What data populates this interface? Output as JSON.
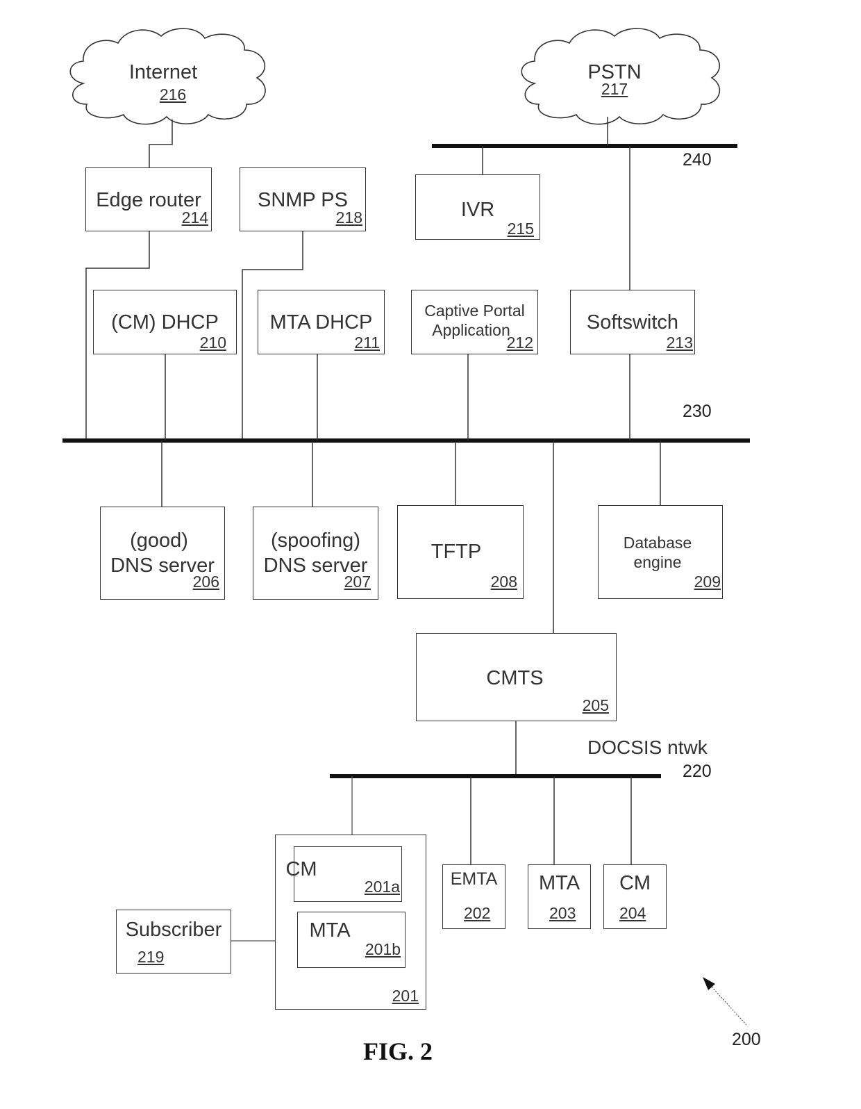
{
  "figure": {
    "caption": "FIG. 2",
    "reference": "200"
  },
  "clouds": {
    "internet": {
      "label": "Internet",
      "ref": "216"
    },
    "pstn": {
      "label": "PSTN",
      "ref": "217"
    }
  },
  "buses": {
    "b240": {
      "label": "240"
    },
    "b230": {
      "label": "230"
    },
    "b220": {
      "name": "DOCSIS ntwk",
      "label": "220"
    }
  },
  "nodes": {
    "edge_router": {
      "label": "Edge router",
      "ref": "214"
    },
    "snmp_ps": {
      "label": "SNMP PS",
      "ref": "218"
    },
    "ivr": {
      "label": "IVR",
      "ref": "215"
    },
    "cm_dhcp": {
      "label": "(CM) DHCP",
      "ref": "210"
    },
    "mta_dhcp": {
      "label": "MTA DHCP",
      "ref": "211"
    },
    "captive_portal": {
      "label_line1": "Captive Portal",
      "label_line2": "Application",
      "ref": "212"
    },
    "softswitch": {
      "label": "Softswitch",
      "ref": "213"
    },
    "good_dns": {
      "label_line1": "(good)",
      "label_line2": "DNS server",
      "ref": "206"
    },
    "spoofing_dns": {
      "label_line1": "(spoofing)",
      "label_line2": "DNS server",
      "ref": "207"
    },
    "tftp": {
      "label": "TFTP",
      "ref": "208"
    },
    "database_engine": {
      "label_line1": "Database",
      "label_line2": "engine",
      "ref": "209"
    },
    "cmts": {
      "label": "CMTS",
      "ref": "205"
    },
    "device_201": {
      "ref": "201"
    },
    "cm_201a": {
      "label": "CM",
      "ref": "201a"
    },
    "mta_201b": {
      "label": "MTA",
      "ref": "201b"
    },
    "emta": {
      "label": "EMTA",
      "ref": "202"
    },
    "mta": {
      "label": "MTA",
      "ref": "203"
    },
    "cm": {
      "label": "CM",
      "ref": "204"
    },
    "subscriber": {
      "label": "Subscriber",
      "ref": "219"
    }
  }
}
